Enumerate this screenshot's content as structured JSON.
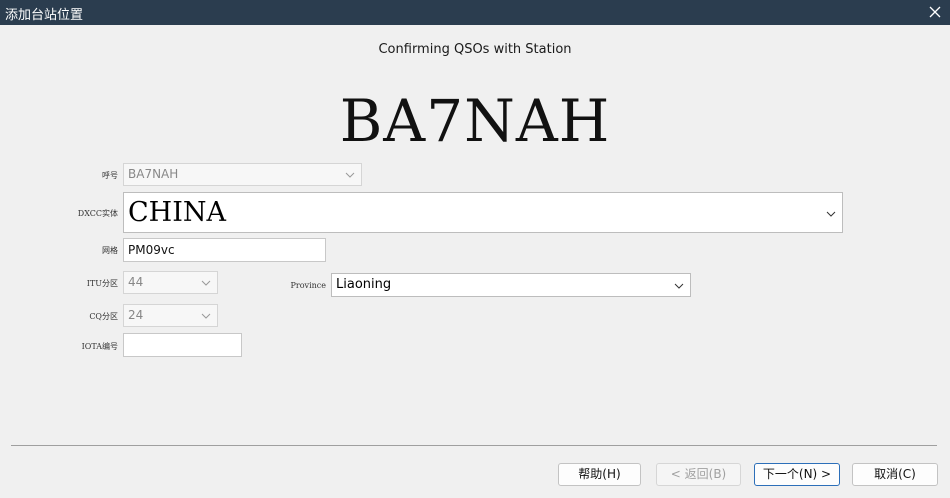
{
  "window": {
    "title": "添加台站位置"
  },
  "header": {
    "subtitle": "Confirming QSOs with Station",
    "callsign_display": "BA7NAH"
  },
  "form": {
    "callsign": {
      "label": "呼号",
      "value": "BA7NAH"
    },
    "dxcc": {
      "label": "DXCC实体",
      "value": "CHINA"
    },
    "grid": {
      "label": "网格",
      "value": "PM09vc"
    },
    "itu": {
      "label": "ITU分区",
      "value": "44"
    },
    "province": {
      "label": "Province",
      "value": "Liaoning"
    },
    "cq": {
      "label": "CQ分区",
      "value": "24"
    },
    "iota": {
      "label": "IOTA编号",
      "value": ""
    }
  },
  "buttons": {
    "help": "帮助(H)",
    "back": "< 返回(B)",
    "next": "下一个(N) >",
    "cancel": "取消(C)"
  },
  "icons": {
    "close": "close-icon",
    "dropdown": "chevron-down-icon"
  }
}
